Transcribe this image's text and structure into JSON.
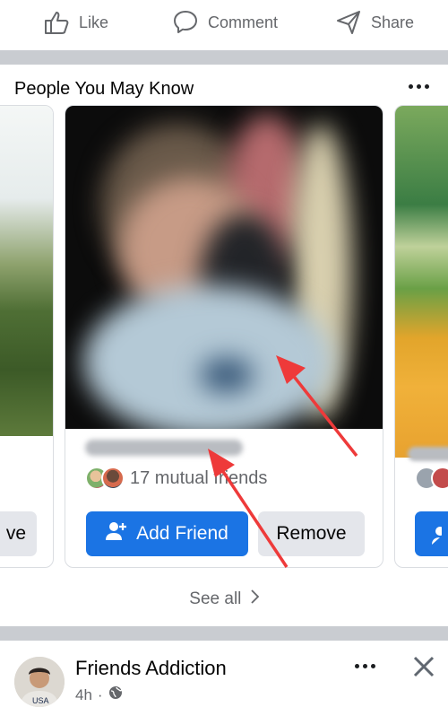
{
  "actions": {
    "like_label": "Like",
    "comment_label": "Comment",
    "share_label": "Share"
  },
  "pymk": {
    "title": "People You May Know",
    "center_card": {
      "mutual_text": "17 mutual friends",
      "add_friend_label": "Add Friend",
      "remove_label": "Remove"
    },
    "left_card": {
      "button_partial_label": "ve"
    },
    "see_all_label": "See all"
  },
  "post": {
    "author": "Friends Addiction",
    "time": "4h",
    "separator": "·"
  },
  "colors": {
    "accent": "#1b74e4",
    "annotation_arrow": "#ee3a3a",
    "secondary_button": "#e4e6eb",
    "divider": "#c9ccd1"
  },
  "icons": [
    "like-icon",
    "comment-icon",
    "share-icon",
    "more-icon",
    "add-person-icon",
    "chevron-right-icon",
    "globe-icon",
    "close-icon"
  ]
}
